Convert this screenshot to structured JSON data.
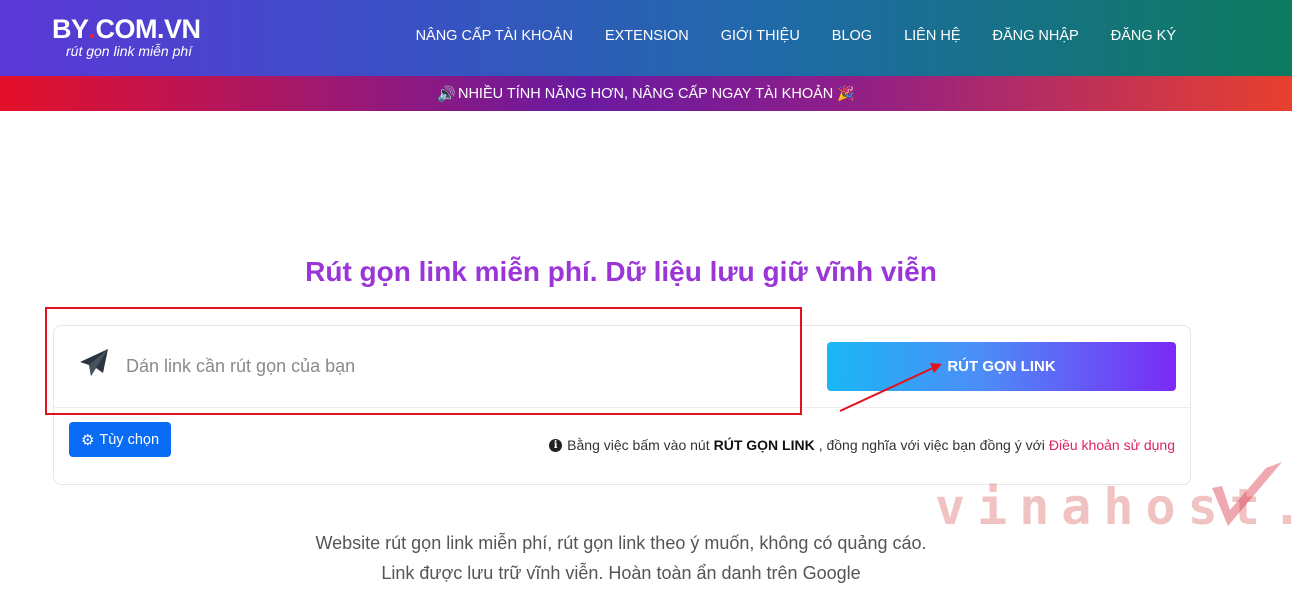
{
  "header": {
    "logo_main_left": "BY",
    "logo_dot": ".",
    "logo_main_right": "COM.VN",
    "logo_sub": "rút gọn link miễn phí",
    "nav": [
      {
        "label": "NÂNG CẤP TÀI KHOẢN"
      },
      {
        "label": "EXTENSION"
      },
      {
        "label": "GIỚI THIỆU"
      },
      {
        "label": "BLOG"
      },
      {
        "label": "LIÊN HỆ"
      },
      {
        "label": "ĐĂNG NHẬP"
      },
      {
        "label": "ĐĂNG KÝ"
      }
    ]
  },
  "promo": {
    "icon": "🔊",
    "text": "NHIỀU TÍNH NĂNG HƠN, NÂNG CẤP NGAY TÀI KHOẢN",
    "emoji": "🎉"
  },
  "main": {
    "headline": "Rút gọn link miễn phí. Dữ liệu lưu giữ vĩnh viễn",
    "input_placeholder": "Dán link cần rút gọn của bạn",
    "input_value": "",
    "shorten_button": "RÚT GỌN LINK",
    "options_button": "Tùy chọn",
    "terms_prefix": "Bằng việc bấm vào nút",
    "terms_bold": "RÚT GỌN LINK",
    "terms_middle": ", đồng nghĩa với việc bạn đồng ý với",
    "terms_link": "Điều khoản sử dụng",
    "desc_line1": "Website rút gọn link miễn phí, rút gọn link theo ý muốn, không có quảng cáo.",
    "desc_line2": "Link được lưu trữ vĩnh viễn. Hoàn toàn ẩn danh trên Google"
  },
  "watermark": {
    "text": "vinahost."
  },
  "colors": {
    "headline": "#9a35d8",
    "options_button": "#0a6cf5",
    "terms_link": "#e0245e",
    "annotation": "#e3101e"
  },
  "icons": {
    "send": "paper-plane-icon",
    "gear": "gear-icon",
    "info": "info-circle-icon",
    "speaker": "speaker-icon"
  }
}
